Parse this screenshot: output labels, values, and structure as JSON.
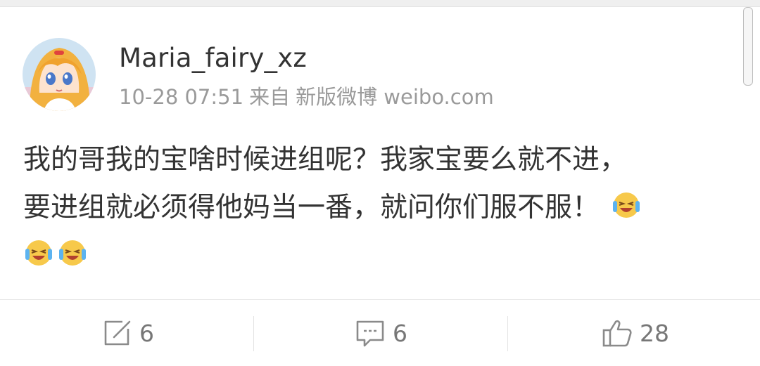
{
  "post": {
    "username": "Maria_fairy_xz",
    "timestamp": "10-28 07:51",
    "source_prefix": "来自",
    "source": "新版微博 weibo.com",
    "text_line1": "我的哥我的宝啥时候进组呢？我家宝要么就不进，",
    "text_line2": "要进组就必须得他妈当一番，就问你们服不服！",
    "emoji": "laugh-cry-emoji"
  },
  "actions": {
    "repost_count": "6",
    "comment_count": "6",
    "like_count": "28"
  },
  "icons": {
    "repost": "edit-share-icon",
    "comment": "comment-bubble-icon",
    "like": "thumbs-up-icon"
  },
  "colors": {
    "username": "#333333",
    "meta": "#9a9a9a",
    "action_text": "#777777"
  }
}
